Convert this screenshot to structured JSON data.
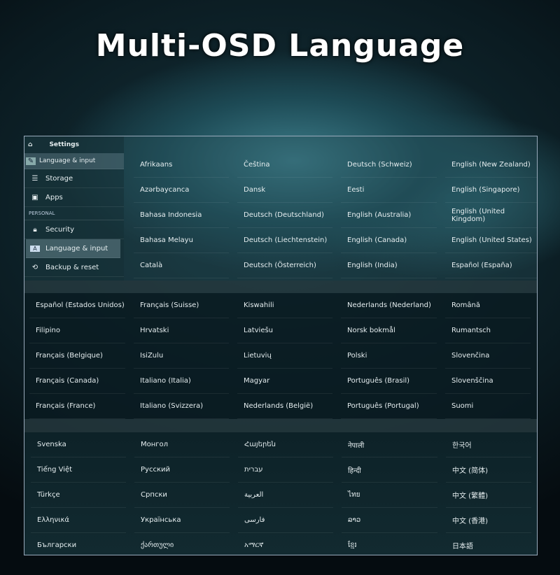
{
  "title": "Multi-OSD Language",
  "sidebar": {
    "header": "Settings",
    "top_item": "Language & input",
    "items": [
      {
        "label": "Storage",
        "icon": "storage-icon"
      },
      {
        "label": "Apps",
        "icon": "apps-icon"
      }
    ],
    "category": "PERSONAL",
    "personal_items": [
      {
        "label": "Security",
        "icon": "lock-icon"
      },
      {
        "label": "Language & input",
        "icon": "keyboard-icon",
        "selected": true
      },
      {
        "label": "Backup & reset",
        "icon": "backup-icon"
      }
    ]
  },
  "section1": [
    "Afrikaans",
    "Čeština",
    "Deutsch (Schweiz)",
    "English (New Zealand)",
    "Azərbaycanca",
    "Dansk",
    "Eesti",
    "English (Singapore)",
    "Bahasa Indonesia",
    "Deutsch (Deutschland)",
    "English (Australia)",
    "English (United Kingdom)",
    "Bahasa Melayu",
    "Deutsch (Liechtenstein)",
    "English (Canada)",
    "English (United States)",
    "Català",
    "Deutsch (Österreich)",
    "English (India)",
    "Español (España)"
  ],
  "section2": [
    "Español (Estados Unidos)",
    "Français (Suisse)",
    "Kiswahili",
    "Nederlands (Nederland)",
    "Română",
    "Filipino",
    "Hrvatski",
    "Latviešu",
    "Norsk bokmål",
    "Rumantsch",
    "Français (Belgique)",
    "IsiZulu",
    "Lietuvių",
    "Polski",
    "Slovenčina",
    "Français (Canada)",
    "Italiano (Italia)",
    "Magyar",
    "Português (Brasil)",
    "Slovenščina",
    "Français (France)",
    "Italiano (Svizzera)",
    "Nederlands (België)",
    "Português (Portugal)",
    "Suomi"
  ],
  "section3": [
    "Svenska",
    "Монгол",
    "Հայերեն",
    "नेपाली",
    "한국어",
    "Tiếng Việt",
    "Русский",
    "עברית",
    "हिन्दी",
    "中文 (简体)",
    "Türkçe",
    "Српски",
    "العربية",
    "ไทย",
    "中文 (繁體)",
    "Ελληνικά",
    "Українська",
    "فارسی",
    "ລາວ",
    "中文 (香港)",
    "Български",
    "ქართული",
    "አማርኛ",
    "ខ្មែរ",
    "日本語"
  ]
}
